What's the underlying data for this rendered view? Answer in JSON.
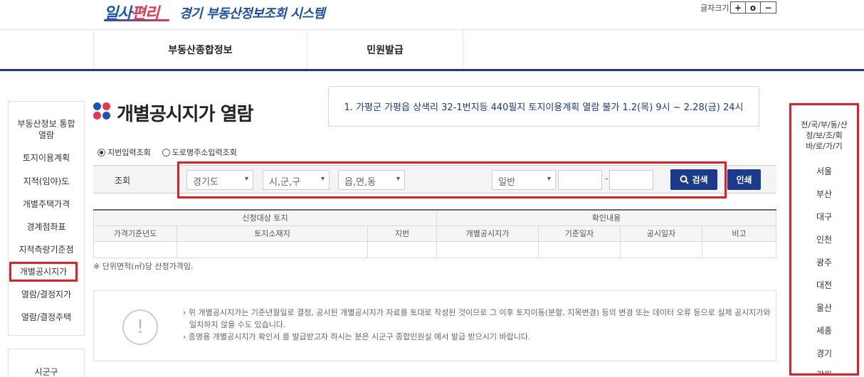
{
  "header": {
    "logo_main": "일사",
    "logo_accent": "편리",
    "site_title": "경기 부동산정보조회 시스템",
    "font_size_label": "글자크기",
    "font_size_buttons": [
      "+",
      "o",
      "−"
    ]
  },
  "nav": {
    "items": [
      "부동산종합정보",
      "민원발급"
    ]
  },
  "left_nav": {
    "items": [
      "부동산정보 통합",
      "열람",
      "토지이용계획",
      "지적(임야)도",
      "개별주택가격",
      "경계점좌표",
      "지적측량기준점",
      "개별공시지가",
      "열람/결정지가",
      "열람/결정주택"
    ],
    "section2": "시군구"
  },
  "page": {
    "title": "개별공시지가 열람",
    "notice": "1. 가평군 가평읍 상색리 32-1번지등 440필지 토지이용계획 열람 불가 1.2(목) 9시 ~ 2.28(금) 24시"
  },
  "search": {
    "radio1": "지번입력조회",
    "radio2": "도로명주소입력조회",
    "label": "조회",
    "select_sido": "경기도",
    "select_sigungu": "시,군,구",
    "select_eup": "읍,면,동",
    "select_type": "일반",
    "dash": "-",
    "search_button": "검색",
    "print_button": "인쇄"
  },
  "table": {
    "group_headers": [
      "신청대상 토지",
      "확인내용"
    ],
    "columns": [
      "가격기준년도",
      "토지소재지",
      "지번",
      "개별공시지가",
      "기준일자",
      "공시일자",
      "비고"
    ]
  },
  "unit_note": "※ 단위면적(㎡)당 산정가격임.",
  "info": {
    "line1": "› 위 개별공시지가는 기준년월일로 결정, 공시된 개별공시지가 자료를 토대로 작성된 것이므로 그 이후 토지이동(분할, 지목변경) 등의 변경 또는 데이터 오류 등으로 실제 공시지가와",
    "line1b": "일치하지 않을 수도 있습니다.",
    "line2": "› 증명용 개별공시지가 확인서 를 발급받고자 하시는 분은 시군구 종합민원실 에서 발급 받으시기 바랍니다.",
    "icon_glyph": "!"
  },
  "right_nav": {
    "heading_line1": "전/국/부/동/산",
    "heading_line2": "정/보/조/회",
    "heading_line3": "바/로/가/기",
    "regions": [
      "서울",
      "부산",
      "대구",
      "인천",
      "광주",
      "대전",
      "울산",
      "세종",
      "경기",
      "강원"
    ]
  },
  "colors": {
    "navy": "#1b3a8c",
    "highlight_red": "#e31e24",
    "dot_red": "#e8384f",
    "dot_blue": "#1a56b0",
    "dot_gray": "#9aa5b8"
  }
}
